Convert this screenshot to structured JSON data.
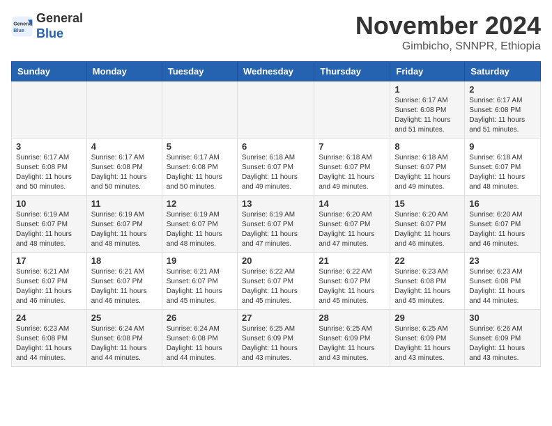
{
  "header": {
    "logo_general": "General",
    "logo_blue": "Blue",
    "month_title": "November 2024",
    "location": "Gimbicho, SNNPR, Ethiopia"
  },
  "weekdays": [
    "Sunday",
    "Monday",
    "Tuesday",
    "Wednesday",
    "Thursday",
    "Friday",
    "Saturday"
  ],
  "weeks": [
    [
      {
        "day": "",
        "info": ""
      },
      {
        "day": "",
        "info": ""
      },
      {
        "day": "",
        "info": ""
      },
      {
        "day": "",
        "info": ""
      },
      {
        "day": "",
        "info": ""
      },
      {
        "day": "1",
        "info": "Sunrise: 6:17 AM\nSunset: 6:08 PM\nDaylight: 11 hours and 51 minutes."
      },
      {
        "day": "2",
        "info": "Sunrise: 6:17 AM\nSunset: 6:08 PM\nDaylight: 11 hours and 51 minutes."
      }
    ],
    [
      {
        "day": "3",
        "info": "Sunrise: 6:17 AM\nSunset: 6:08 PM\nDaylight: 11 hours and 50 minutes."
      },
      {
        "day": "4",
        "info": "Sunrise: 6:17 AM\nSunset: 6:08 PM\nDaylight: 11 hours and 50 minutes."
      },
      {
        "day": "5",
        "info": "Sunrise: 6:17 AM\nSunset: 6:08 PM\nDaylight: 11 hours and 50 minutes."
      },
      {
        "day": "6",
        "info": "Sunrise: 6:18 AM\nSunset: 6:07 PM\nDaylight: 11 hours and 49 minutes."
      },
      {
        "day": "7",
        "info": "Sunrise: 6:18 AM\nSunset: 6:07 PM\nDaylight: 11 hours and 49 minutes."
      },
      {
        "day": "8",
        "info": "Sunrise: 6:18 AM\nSunset: 6:07 PM\nDaylight: 11 hours and 49 minutes."
      },
      {
        "day": "9",
        "info": "Sunrise: 6:18 AM\nSunset: 6:07 PM\nDaylight: 11 hours and 48 minutes."
      }
    ],
    [
      {
        "day": "10",
        "info": "Sunrise: 6:19 AM\nSunset: 6:07 PM\nDaylight: 11 hours and 48 minutes."
      },
      {
        "day": "11",
        "info": "Sunrise: 6:19 AM\nSunset: 6:07 PM\nDaylight: 11 hours and 48 minutes."
      },
      {
        "day": "12",
        "info": "Sunrise: 6:19 AM\nSunset: 6:07 PM\nDaylight: 11 hours and 48 minutes."
      },
      {
        "day": "13",
        "info": "Sunrise: 6:19 AM\nSunset: 6:07 PM\nDaylight: 11 hours and 47 minutes."
      },
      {
        "day": "14",
        "info": "Sunrise: 6:20 AM\nSunset: 6:07 PM\nDaylight: 11 hours and 47 minutes."
      },
      {
        "day": "15",
        "info": "Sunrise: 6:20 AM\nSunset: 6:07 PM\nDaylight: 11 hours and 46 minutes."
      },
      {
        "day": "16",
        "info": "Sunrise: 6:20 AM\nSunset: 6:07 PM\nDaylight: 11 hours and 46 minutes."
      }
    ],
    [
      {
        "day": "17",
        "info": "Sunrise: 6:21 AM\nSunset: 6:07 PM\nDaylight: 11 hours and 46 minutes."
      },
      {
        "day": "18",
        "info": "Sunrise: 6:21 AM\nSunset: 6:07 PM\nDaylight: 11 hours and 46 minutes."
      },
      {
        "day": "19",
        "info": "Sunrise: 6:21 AM\nSunset: 6:07 PM\nDaylight: 11 hours and 45 minutes."
      },
      {
        "day": "20",
        "info": "Sunrise: 6:22 AM\nSunset: 6:07 PM\nDaylight: 11 hours and 45 minutes."
      },
      {
        "day": "21",
        "info": "Sunrise: 6:22 AM\nSunset: 6:07 PM\nDaylight: 11 hours and 45 minutes."
      },
      {
        "day": "22",
        "info": "Sunrise: 6:23 AM\nSunset: 6:08 PM\nDaylight: 11 hours and 45 minutes."
      },
      {
        "day": "23",
        "info": "Sunrise: 6:23 AM\nSunset: 6:08 PM\nDaylight: 11 hours and 44 minutes."
      }
    ],
    [
      {
        "day": "24",
        "info": "Sunrise: 6:23 AM\nSunset: 6:08 PM\nDaylight: 11 hours and 44 minutes."
      },
      {
        "day": "25",
        "info": "Sunrise: 6:24 AM\nSunset: 6:08 PM\nDaylight: 11 hours and 44 minutes."
      },
      {
        "day": "26",
        "info": "Sunrise: 6:24 AM\nSunset: 6:08 PM\nDaylight: 11 hours and 44 minutes."
      },
      {
        "day": "27",
        "info": "Sunrise: 6:25 AM\nSunset: 6:09 PM\nDaylight: 11 hours and 43 minutes."
      },
      {
        "day": "28",
        "info": "Sunrise: 6:25 AM\nSunset: 6:09 PM\nDaylight: 11 hours and 43 minutes."
      },
      {
        "day": "29",
        "info": "Sunrise: 6:25 AM\nSunset: 6:09 PM\nDaylight: 11 hours and 43 minutes."
      },
      {
        "day": "30",
        "info": "Sunrise: 6:26 AM\nSunset: 6:09 PM\nDaylight: 11 hours and 43 minutes."
      }
    ]
  ]
}
